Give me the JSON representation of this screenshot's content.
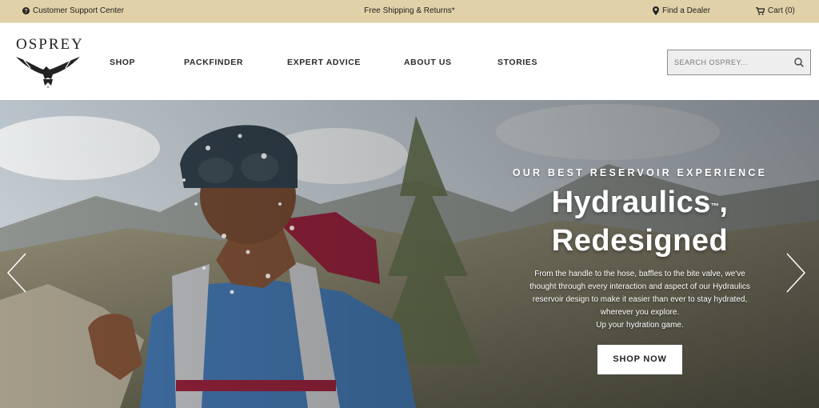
{
  "utility_bar": {
    "support_label": "Customer Support Center",
    "shipping_label": "Free Shipping & Returns*",
    "dealer_label": "Find a Dealer",
    "cart_label": "Cart (0)"
  },
  "header": {
    "logo_text": "OSPREY",
    "nav": [
      {
        "label": "SHOP"
      },
      {
        "label": "PACKFINDER"
      },
      {
        "label": "EXPERT ADVICE"
      },
      {
        "label": "ABOUT US"
      },
      {
        "label": "STORIES"
      }
    ],
    "search": {
      "placeholder": "SEARCH OSPREY...",
      "value": ""
    }
  },
  "hero": {
    "eyebrow": "OUR BEST RESERVOIR EXPERIENCE",
    "headline_line1": "Hydraulics",
    "trademark": "™",
    "headline_comma": ",",
    "headline_line2": "Redesigned",
    "body": "From the handle to the hose, baffles to the bite valve, we've thought through every interaction and aspect of our Hydraulics reservoir design to make it easier than ever to stay hydrated, wherever you explore.",
    "body_last": "Up your hydration game.",
    "cta_label": "SHOP NOW"
  },
  "icons": {
    "support": "question-circle-icon",
    "dealer": "map-pin-icon",
    "cart": "cart-icon",
    "search": "search-icon",
    "prev": "chevron-left-icon",
    "next": "chevron-right-icon"
  },
  "colors": {
    "utility_bar_bg": "#e1d1a8",
    "text_dark": "#222222",
    "hero_text": "#ffffff",
    "cta_bg": "#ffffff"
  }
}
